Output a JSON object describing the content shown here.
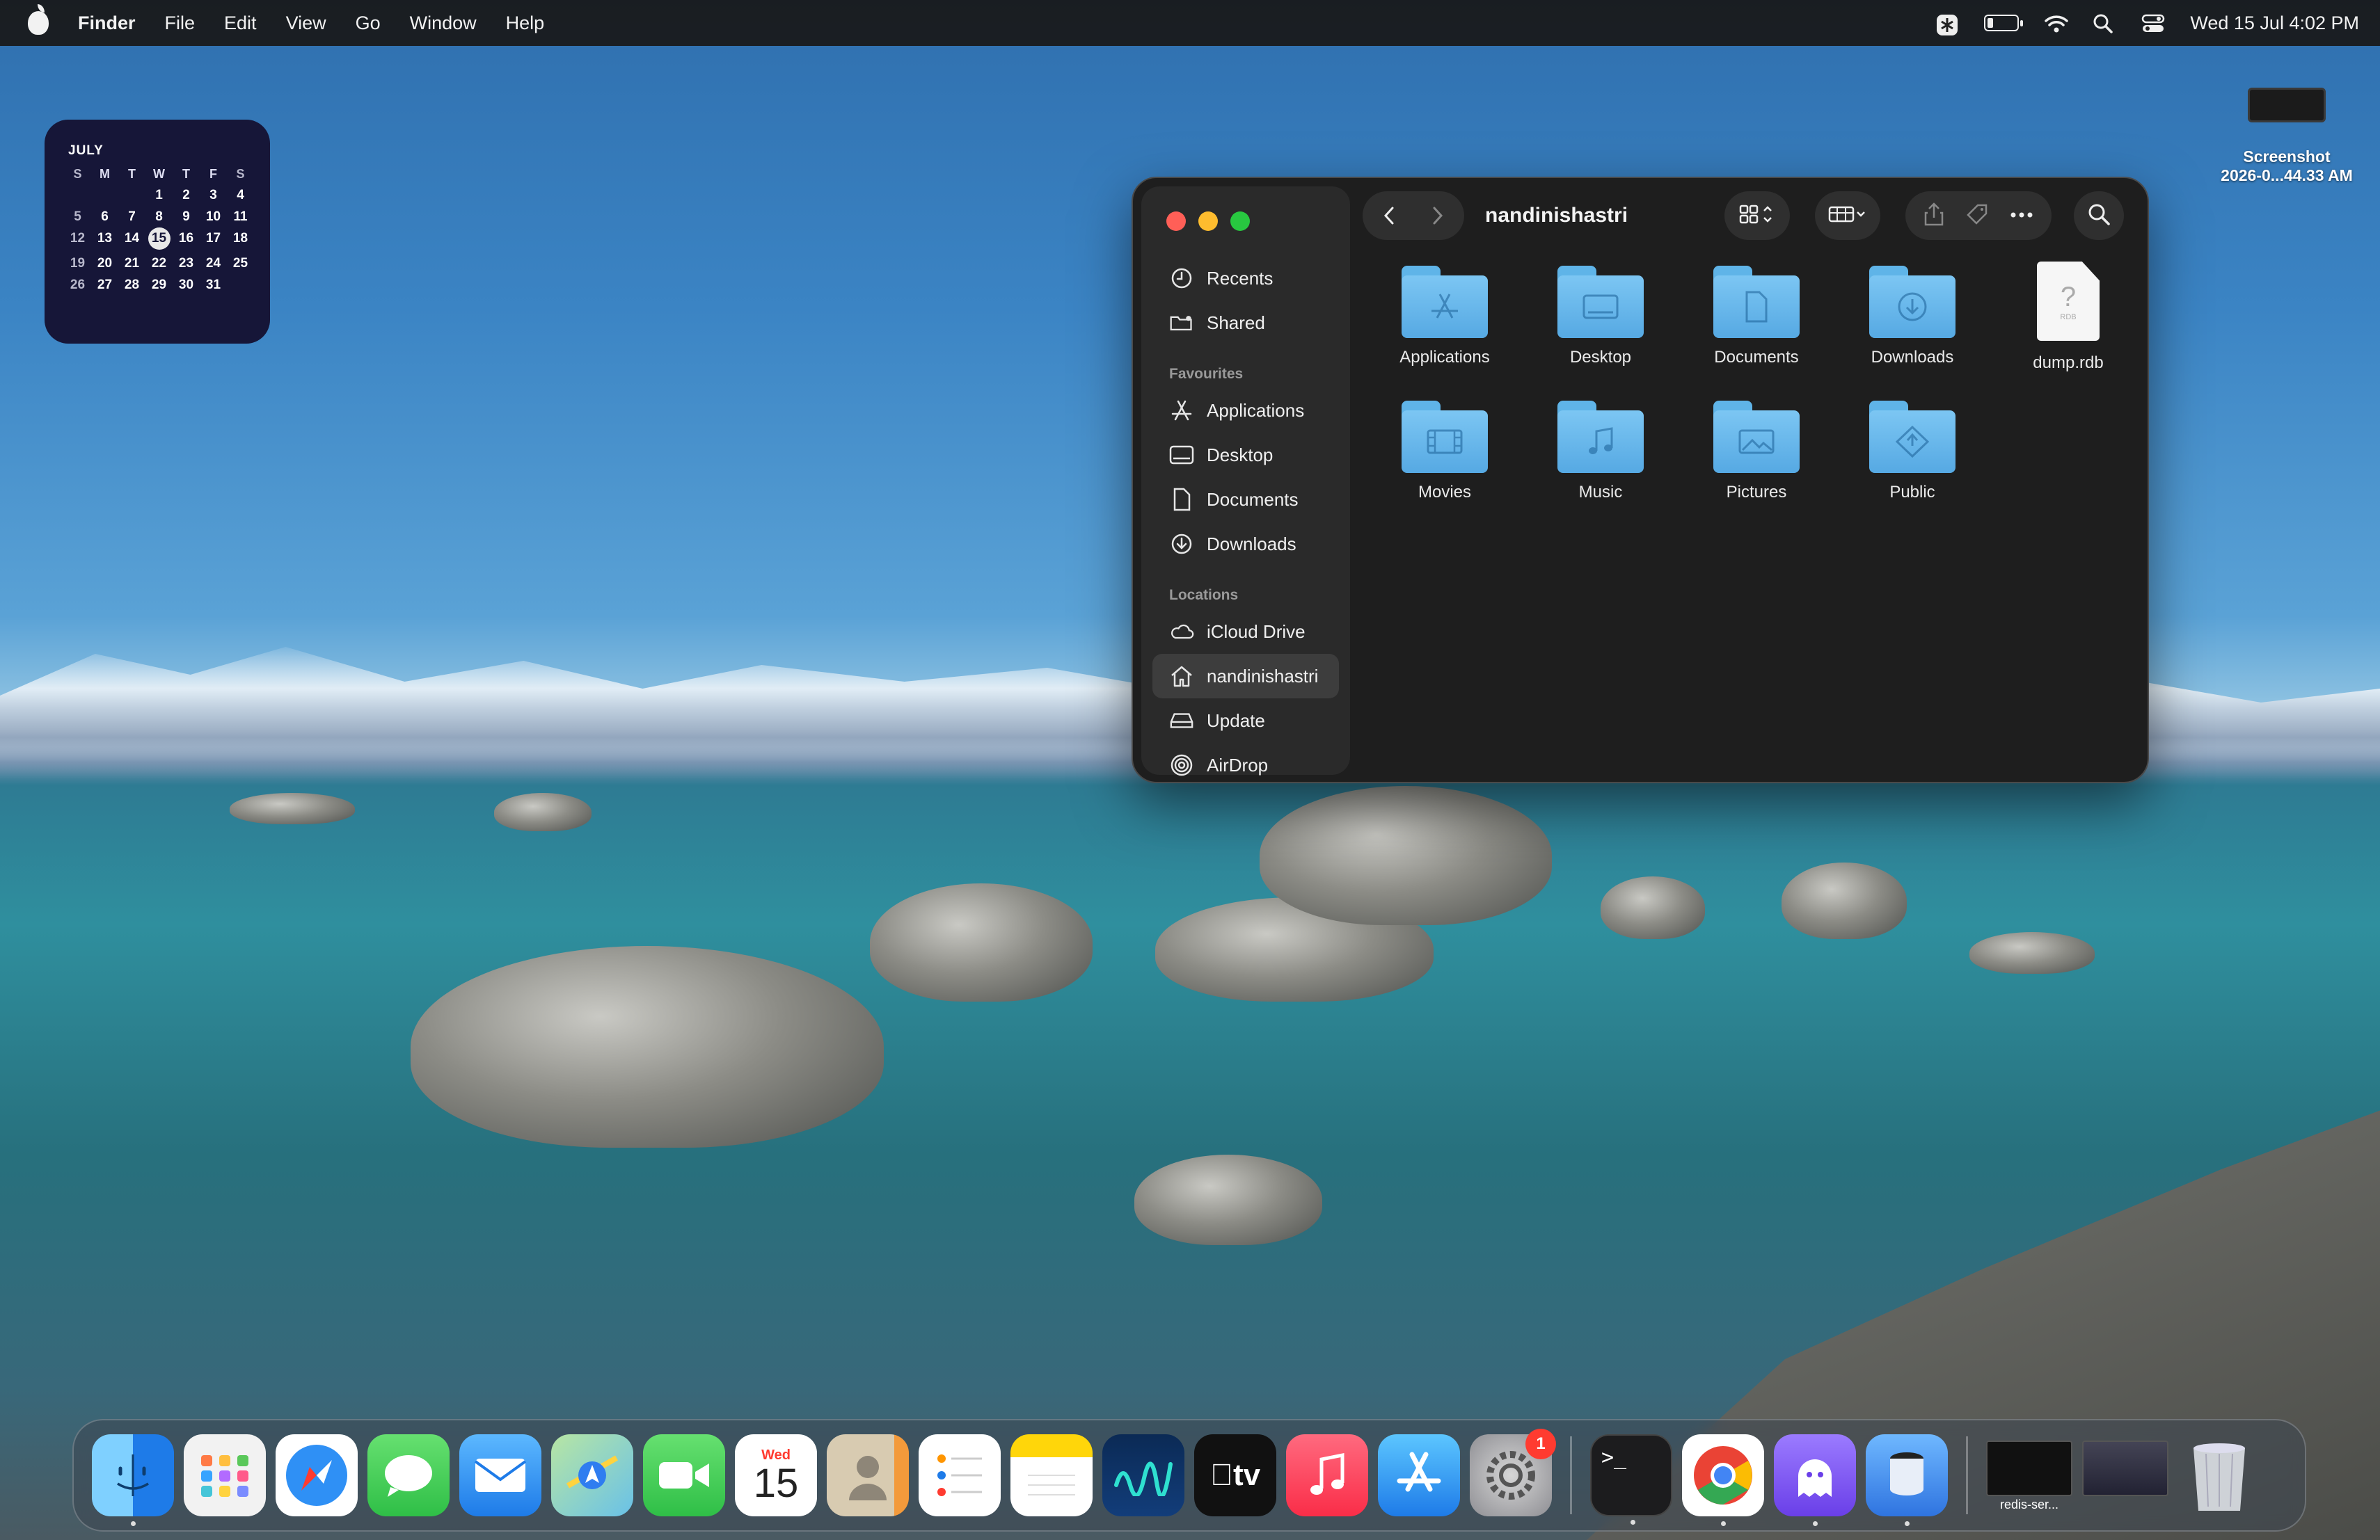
{
  "menubar": {
    "app_name": "Finder",
    "menus": [
      "File",
      "Edit",
      "View",
      "Go",
      "Window",
      "Help"
    ],
    "clock": "Wed 15 Jul  4:02 PM"
  },
  "calendar": {
    "month": "JULY",
    "weekdays": [
      "S",
      "M",
      "T",
      "W",
      "T",
      "F",
      "S"
    ],
    "weeks": [
      [
        "",
        "",
        "",
        "1",
        "2",
        "3",
        "4"
      ],
      [
        "5",
        "6",
        "7",
        "8",
        "9",
        "10",
        "11"
      ],
      [
        "12",
        "13",
        "14",
        "15",
        "16",
        "17",
        "18"
      ],
      [
        "19",
        "20",
        "21",
        "22",
        "23",
        "24",
        "25"
      ],
      [
        "26",
        "27",
        "28",
        "29",
        "30",
        "31",
        ""
      ]
    ],
    "today": "15"
  },
  "desktop_file": {
    "line1": "Screenshot",
    "line2": "2026-0...44.33 AM"
  },
  "finder": {
    "title": "nandinishastri",
    "sidebar_top": [
      {
        "label": "Recents",
        "icon": "clock-icon"
      },
      {
        "label": "Shared",
        "icon": "shared-folder-icon"
      }
    ],
    "favourites_heading": "Favourites",
    "favourites": [
      {
        "label": "Applications",
        "icon": "applications-icon"
      },
      {
        "label": "Desktop",
        "icon": "desktop-icon"
      },
      {
        "label": "Documents",
        "icon": "document-icon"
      },
      {
        "label": "Downloads",
        "icon": "download-icon"
      }
    ],
    "locations_heading": "Locations",
    "locations": [
      {
        "label": "iCloud Drive",
        "icon": "cloud-icon"
      },
      {
        "label": "nandinishastri",
        "icon": "home-icon",
        "selected": true
      },
      {
        "label": "Update",
        "icon": "drive-icon"
      },
      {
        "label": "AirDrop",
        "icon": "airdrop-icon"
      }
    ],
    "items": [
      {
        "label": "Applications",
        "kind": "folder",
        "glyph": "applications"
      },
      {
        "label": "Desktop",
        "kind": "folder",
        "glyph": "desktop"
      },
      {
        "label": "Documents",
        "kind": "folder",
        "glyph": "documents"
      },
      {
        "label": "Downloads",
        "kind": "folder",
        "glyph": "downloads"
      },
      {
        "label": "dump.rdb",
        "kind": "file",
        "ext": "RDB"
      },
      {
        "label": "Movies",
        "kind": "folder",
        "glyph": "movies"
      },
      {
        "label": "Music",
        "kind": "folder",
        "glyph": "music"
      },
      {
        "label": "Pictures",
        "kind": "folder",
        "glyph": "pictures"
      },
      {
        "label": "Public",
        "kind": "folder",
        "glyph": "public"
      }
    ]
  },
  "dock": {
    "apps": [
      {
        "name": "finder",
        "color": "#1e8ef0",
        "running": true
      },
      {
        "name": "launchpad",
        "color": "#f0f0f0"
      },
      {
        "name": "safari",
        "color": "#2a8cf0"
      },
      {
        "name": "messages",
        "color": "#34c759"
      },
      {
        "name": "mail",
        "color": "#3a9bf5"
      },
      {
        "name": "maps",
        "color": "#7bd06a"
      },
      {
        "name": "facetime",
        "color": "#34c759"
      },
      {
        "name": "calendar",
        "color": "#ffffff"
      },
      {
        "name": "contacts",
        "color": "#c8b89a"
      },
      {
        "name": "reminders",
        "color": "#ffffff"
      },
      {
        "name": "notes",
        "color": "#ffd60a"
      },
      {
        "name": "freeform",
        "color": "#0a2a55"
      },
      {
        "name": "tv",
        "color": "#111111"
      },
      {
        "name": "music",
        "color": "#fa2d48"
      },
      {
        "name": "app-store",
        "color": "#1e90ff"
      },
      {
        "name": "system-settings",
        "color": "#8e8e93",
        "badge": "1"
      }
    ],
    "calendar_icon": {
      "day": "Wed",
      "date": "15"
    },
    "tv_label": "tv",
    "recent_apps": [
      {
        "name": "terminal",
        "color": "#1c1c1e",
        "running": true
      },
      {
        "name": "chrome",
        "color": "#ffffff",
        "running": true
      },
      {
        "name": "ghost-app",
        "color": "#7a5af8",
        "running": true
      },
      {
        "name": "db-app",
        "color": "#3b8cf5",
        "running": true
      }
    ],
    "minimized_window_label": "redis-ser..."
  },
  "colors": {
    "close": "#ff5f57",
    "minimize": "#febc2e",
    "zoom": "#28c840",
    "folder": "#64b6ec"
  }
}
